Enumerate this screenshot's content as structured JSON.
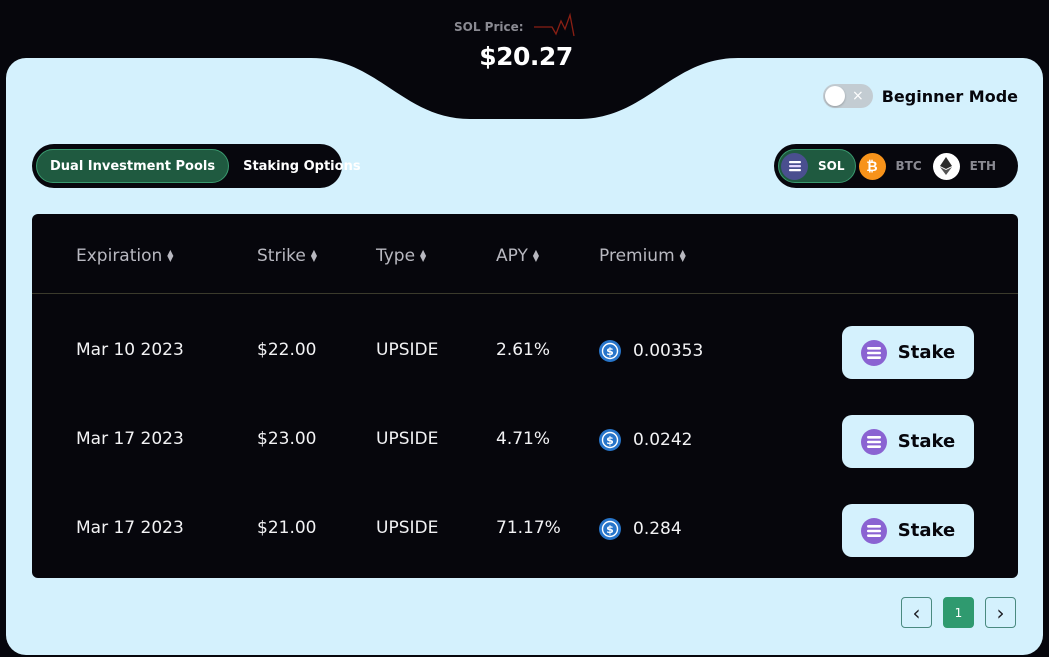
{
  "header": {
    "price_label": "SOL Price:",
    "price_value": "$20.27"
  },
  "beginner_mode": {
    "label": "Beginner Mode",
    "enabled": false,
    "toggle_glyph": "×"
  },
  "tabs": [
    {
      "label": "Dual Investment Pools",
      "active": true
    },
    {
      "label": "Staking Options",
      "active": false
    }
  ],
  "coins": [
    {
      "label": "SOL",
      "icon": "solana-icon",
      "active": true
    },
    {
      "label": "BTC",
      "icon": "bitcoin-icon",
      "active": false
    },
    {
      "label": "ETH",
      "icon": "ethereum-icon",
      "active": false
    }
  ],
  "table": {
    "columns": [
      "Expiration",
      "Strike",
      "Type",
      "APY",
      "Premium"
    ],
    "rows": [
      {
        "expiration": "Mar 10 2023",
        "strike": "$22.00",
        "type": "UPSIDE",
        "apy": "2.61%",
        "premium": "0.00353",
        "action": "Stake"
      },
      {
        "expiration": "Mar 17 2023",
        "strike": "$23.00",
        "type": "UPSIDE",
        "apy": "4.71%",
        "premium": "0.0242",
        "action": "Stake"
      },
      {
        "expiration": "Mar 17 2023",
        "strike": "$21.00",
        "type": "UPSIDE",
        "apy": "71.17%",
        "premium": "0.284",
        "action": "Stake"
      }
    ]
  },
  "pagination": {
    "prev": "‹",
    "current": "1",
    "next": "›"
  },
  "colors": {
    "background": "#06060c",
    "panel": "#d4f1fd",
    "accent_green": "#1f5a40",
    "page_active": "#2f9a6f",
    "usdc_blue": "#2775ca"
  }
}
